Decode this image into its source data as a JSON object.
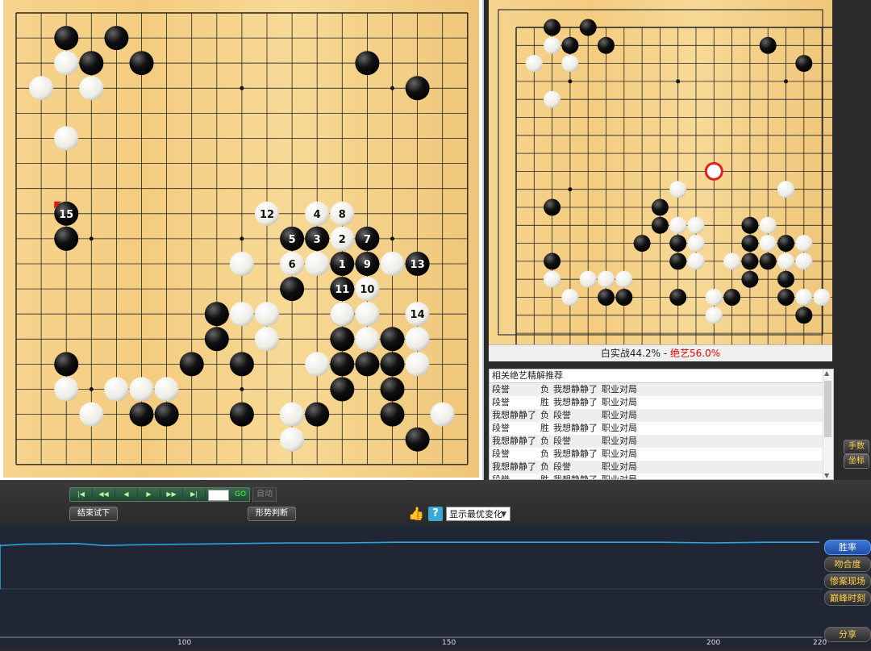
{
  "main_board": {
    "size": 19,
    "star_points": [
      [
        3,
        3
      ],
      [
        3,
        9
      ],
      [
        3,
        15
      ],
      [
        9,
        3
      ],
      [
        9,
        9
      ],
      [
        9,
        15
      ],
      [
        15,
        3
      ],
      [
        15,
        9
      ],
      [
        15,
        15
      ]
    ],
    "black_stones": [
      [
        2,
        1
      ],
      [
        4,
        1
      ],
      [
        3,
        2
      ],
      [
        5,
        2
      ],
      [
        14,
        2
      ],
      [
        16,
        3
      ],
      [
        2,
        9
      ],
      [
        8,
        12
      ],
      [
        12,
        9
      ],
      [
        11,
        11
      ],
      [
        8,
        13
      ],
      [
        7,
        14
      ],
      [
        9,
        14
      ],
      [
        2,
        14
      ],
      [
        5,
        16
      ],
      [
        6,
        16
      ],
      [
        9,
        16
      ],
      [
        12,
        16
      ],
      [
        15,
        13
      ],
      [
        14,
        14
      ],
      [
        13,
        14
      ],
      [
        13,
        13
      ],
      [
        13,
        12
      ],
      [
        13,
        15
      ],
      [
        15,
        15
      ],
      [
        15,
        16
      ],
      [
        16,
        17
      ]
    ],
    "white_stones": [
      [
        2,
        2
      ],
      [
        1,
        3
      ],
      [
        3,
        3
      ],
      [
        2,
        5
      ],
      [
        9,
        10
      ],
      [
        9,
        12
      ],
      [
        10,
        12
      ],
      [
        10,
        13
      ],
      [
        13,
        12
      ],
      [
        14,
        13
      ],
      [
        16,
        13
      ],
      [
        16,
        14
      ],
      [
        12,
        14
      ],
      [
        2,
        15
      ],
      [
        4,
        15
      ],
      [
        5,
        15
      ],
      [
        6,
        15
      ],
      [
        3,
        16
      ],
      [
        11,
        16
      ],
      [
        11,
        17
      ],
      [
        17,
        16
      ]
    ],
    "numbered_stones": [
      {
        "c": 13,
        "r": 10,
        "color": "black",
        "num": "1"
      },
      {
        "c": 13,
        "r": 9,
        "color": "white",
        "num": "2"
      },
      {
        "c": 12,
        "r": 9,
        "color": "black",
        "num": "3"
      },
      {
        "c": 12,
        "r": 8,
        "color": "white",
        "num": "4"
      },
      {
        "c": 11,
        "r": 9,
        "color": "black",
        "num": "5"
      },
      {
        "c": 11,
        "r": 10,
        "color": "white",
        "num": "6"
      },
      {
        "c": 14,
        "r": 9,
        "color": "black",
        "num": "7"
      },
      {
        "c": 13,
        "r": 8,
        "color": "white",
        "num": "8"
      },
      {
        "c": 14,
        "r": 10,
        "color": "black",
        "num": "9"
      },
      {
        "c": 14,
        "r": 11,
        "color": "white",
        "num": "10"
      },
      {
        "c": 13,
        "r": 11,
        "color": "black",
        "num": "11"
      },
      {
        "c": 10,
        "r": 8,
        "color": "white",
        "num": "12"
      },
      {
        "c": 16,
        "r": 10,
        "color": "black",
        "num": "13"
      },
      {
        "c": 16,
        "r": 12,
        "color": "white",
        "num": "14"
      },
      {
        "c": 2,
        "r": 8,
        "color": "black",
        "num": "15"
      }
    ],
    "extra_white": [
      [
        12,
        10
      ],
      [
        15,
        10
      ],
      [
        14,
        12
      ]
    ],
    "extra_black": [
      [
        13,
        12
      ],
      [
        15,
        14
      ]
    ],
    "last_move_marker": [
      2,
      8
    ]
  },
  "sub_board": {
    "size": 19,
    "star_points": [
      [
        3,
        3
      ],
      [
        9,
        3
      ],
      [
        15,
        3
      ],
      [
        3,
        9
      ],
      [
        9,
        9
      ],
      [
        15,
        9
      ],
      [
        3,
        15
      ],
      [
        9,
        15
      ],
      [
        15,
        15
      ]
    ],
    "black_stones": [
      [
        2,
        0
      ],
      [
        4,
        0
      ],
      [
        3,
        1
      ],
      [
        5,
        1
      ],
      [
        14,
        1
      ],
      [
        16,
        2
      ],
      [
        2,
        10
      ],
      [
        8,
        10
      ],
      [
        8,
        11
      ],
      [
        7,
        12
      ],
      [
        9,
        12
      ],
      [
        9,
        13
      ],
      [
        2,
        13
      ],
      [
        5,
        15
      ],
      [
        6,
        15
      ],
      [
        9,
        15
      ],
      [
        12,
        15
      ],
      [
        13,
        11
      ],
      [
        13,
        12
      ],
      [
        13,
        13
      ],
      [
        14,
        13
      ],
      [
        15,
        12
      ],
      [
        15,
        14
      ],
      [
        13,
        14
      ],
      [
        15,
        15
      ],
      [
        16,
        16
      ]
    ],
    "white_stones": [
      [
        2,
        1
      ],
      [
        1,
        2
      ],
      [
        3,
        2
      ],
      [
        2,
        4
      ],
      [
        9,
        9
      ],
      [
        15,
        9
      ],
      [
        9,
        11
      ],
      [
        10,
        11
      ],
      [
        10,
        12
      ],
      [
        10,
        13
      ],
      [
        12,
        13
      ],
      [
        14,
        11
      ],
      [
        14,
        12
      ],
      [
        16,
        12
      ],
      [
        16,
        13
      ],
      [
        15,
        13
      ],
      [
        2,
        14
      ],
      [
        4,
        14
      ],
      [
        5,
        14
      ],
      [
        6,
        14
      ],
      [
        3,
        15
      ],
      [
        11,
        15
      ],
      [
        11,
        16
      ],
      [
        16,
        15
      ],
      [
        17,
        15
      ]
    ],
    "highlight_move": [
      11,
      8
    ]
  },
  "winrate": {
    "white_label": "白实战44.2%",
    "separator": " - ",
    "ai_label": "绝艺56.0%"
  },
  "recommend": {
    "title": "相关绝艺精解推荐",
    "rows": [
      {
        "p1": "段誉",
        "res": "负",
        "p2": "我想静静了",
        "type": "职业对局"
      },
      {
        "p1": "段誉",
        "res": "胜",
        "p2": "我想静静了",
        "type": "职业对局"
      },
      {
        "p1": "我想静静了",
        "res": "负",
        "p2": "段誉",
        "type": "职业对局"
      },
      {
        "p1": "段誉",
        "res": "胜",
        "p2": "我想静静了",
        "type": "职业对局"
      },
      {
        "p1": "我想静静了",
        "res": "负",
        "p2": "段誉",
        "type": "职业对局"
      },
      {
        "p1": "段誉",
        "res": "负",
        "p2": "我想静静了",
        "type": "职业对局"
      },
      {
        "p1": "我想静静了",
        "res": "负",
        "p2": "段誉",
        "type": "职业对局"
      },
      {
        "p1": "段誉",
        "res": "胜",
        "p2": "我想静静了",
        "type": "职业对局"
      }
    ]
  },
  "side_buttons": {
    "moves": "手数",
    "coords": "坐标"
  },
  "controls": {
    "nav": [
      "|◀",
      "◀◀",
      "◀",
      "▶",
      "▶▶",
      "▶|"
    ],
    "go": "GO",
    "auto": "自动",
    "end_trial": "结束试下",
    "judge": "形势判断",
    "variation_select": "显示最优变化"
  },
  "graph": {
    "tabs": [
      "胜率",
      "吻合度",
      "惨案现场",
      "巅峰时刻"
    ],
    "share": "分享",
    "x_ticks": [
      "100",
      "150",
      "200",
      "220"
    ],
    "line_color": "#2aa7e0",
    "chart_data": {
      "type": "line",
      "x": [
        52,
        53,
        54,
        55,
        56,
        57,
        58,
        59,
        60,
        61,
        62,
        63,
        65,
        70,
        80,
        85,
        90,
        100,
        110,
        120,
        130,
        140,
        150,
        160,
        170,
        180,
        190,
        200,
        210,
        220
      ],
      "values": [
        0.4,
        0.55,
        0.3,
        0.6,
        0.35,
        0.7,
        0.6,
        0.35,
        0.7,
        0.98,
        0.97,
        0.98,
        0.96,
        0.98,
        0.99,
        0.96,
        0.97,
        0.98,
        0.99,
        1.0,
        1.0,
        1.01,
        1.01,
        1.01,
        1.01,
        1.01,
        1.01,
        1.0,
        1.01,
        1.01
      ]
    }
  }
}
